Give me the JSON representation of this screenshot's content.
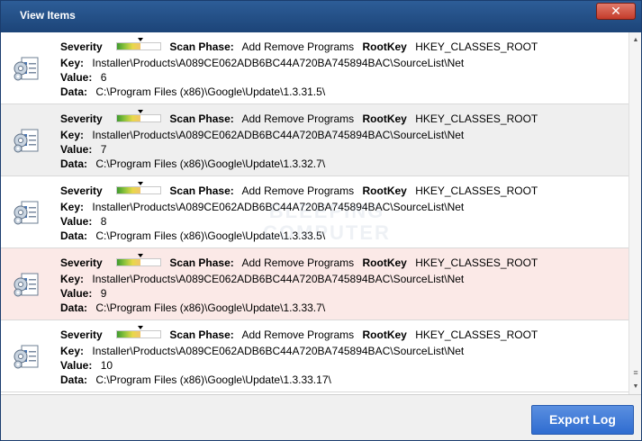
{
  "window": {
    "title": "View Items",
    "close_glyph": "✕"
  },
  "labels": {
    "severity": "Severity",
    "scan_phase": "Scan Phase:",
    "rootkey": "RootKey",
    "key": "Key:",
    "value": "Value:",
    "data": "Data:"
  },
  "items": [
    {
      "severity_level": 0.55,
      "scan_phase": "Add Remove Programs",
      "rootkey": "HKEY_CLASSES_ROOT",
      "key": "Installer\\Products\\A089CE062ADB6BC44A720BA745894BAC\\SourceList\\Net",
      "value": "6",
      "data": "C:\\Program Files (x86)\\Google\\Update\\1.3.31.5\\",
      "background": "#ffffff",
      "icon": "registry-document-icon"
    },
    {
      "severity_level": 0.55,
      "scan_phase": "Add Remove Programs",
      "rootkey": "HKEY_CLASSES_ROOT",
      "key": "Installer\\Products\\A089CE062ADB6BC44A720BA745894BAC\\SourceList\\Net",
      "value": "7",
      "data": "C:\\Program Files (x86)\\Google\\Update\\1.3.32.7\\",
      "background": "#efefef",
      "icon": "registry-document-icon"
    },
    {
      "severity_level": 0.55,
      "scan_phase": "Add Remove Programs",
      "rootkey": "HKEY_CLASSES_ROOT",
      "key": "Installer\\Products\\A089CE062ADB6BC44A720BA745894BAC\\SourceList\\Net",
      "value": "8",
      "data": "C:\\Program Files (x86)\\Google\\Update\\1.3.33.5\\",
      "background": "#ffffff",
      "icon": "registry-document-icon"
    },
    {
      "severity_level": 0.55,
      "scan_phase": "Add Remove Programs",
      "rootkey": "HKEY_CLASSES_ROOT",
      "key": "Installer\\Products\\A089CE062ADB6BC44A720BA745894BAC\\SourceList\\Net",
      "value": "9",
      "data": "C:\\Program Files (x86)\\Google\\Update\\1.3.33.7\\",
      "background": "#fbe9e7",
      "icon": "registry-document-icon"
    },
    {
      "severity_level": 0.55,
      "scan_phase": "Add Remove Programs",
      "rootkey": "HKEY_CLASSES_ROOT",
      "key": "Installer\\Products\\A089CE062ADB6BC44A720BA745894BAC\\SourceList\\Net",
      "value": "10",
      "data": "C:\\Program Files (x86)\\Google\\Update\\1.3.33.17\\",
      "background": "#ffffff",
      "icon": "registry-document-icon"
    }
  ],
  "footer": {
    "export_label": "Export Log"
  },
  "watermark": {
    "line1": "BLEEPING",
    "line2": "COMPUTER"
  },
  "colors": {
    "titlebar": "#2d5d97",
    "export_button": "#3b78d8",
    "highlight_row": "#fbe9e7"
  }
}
